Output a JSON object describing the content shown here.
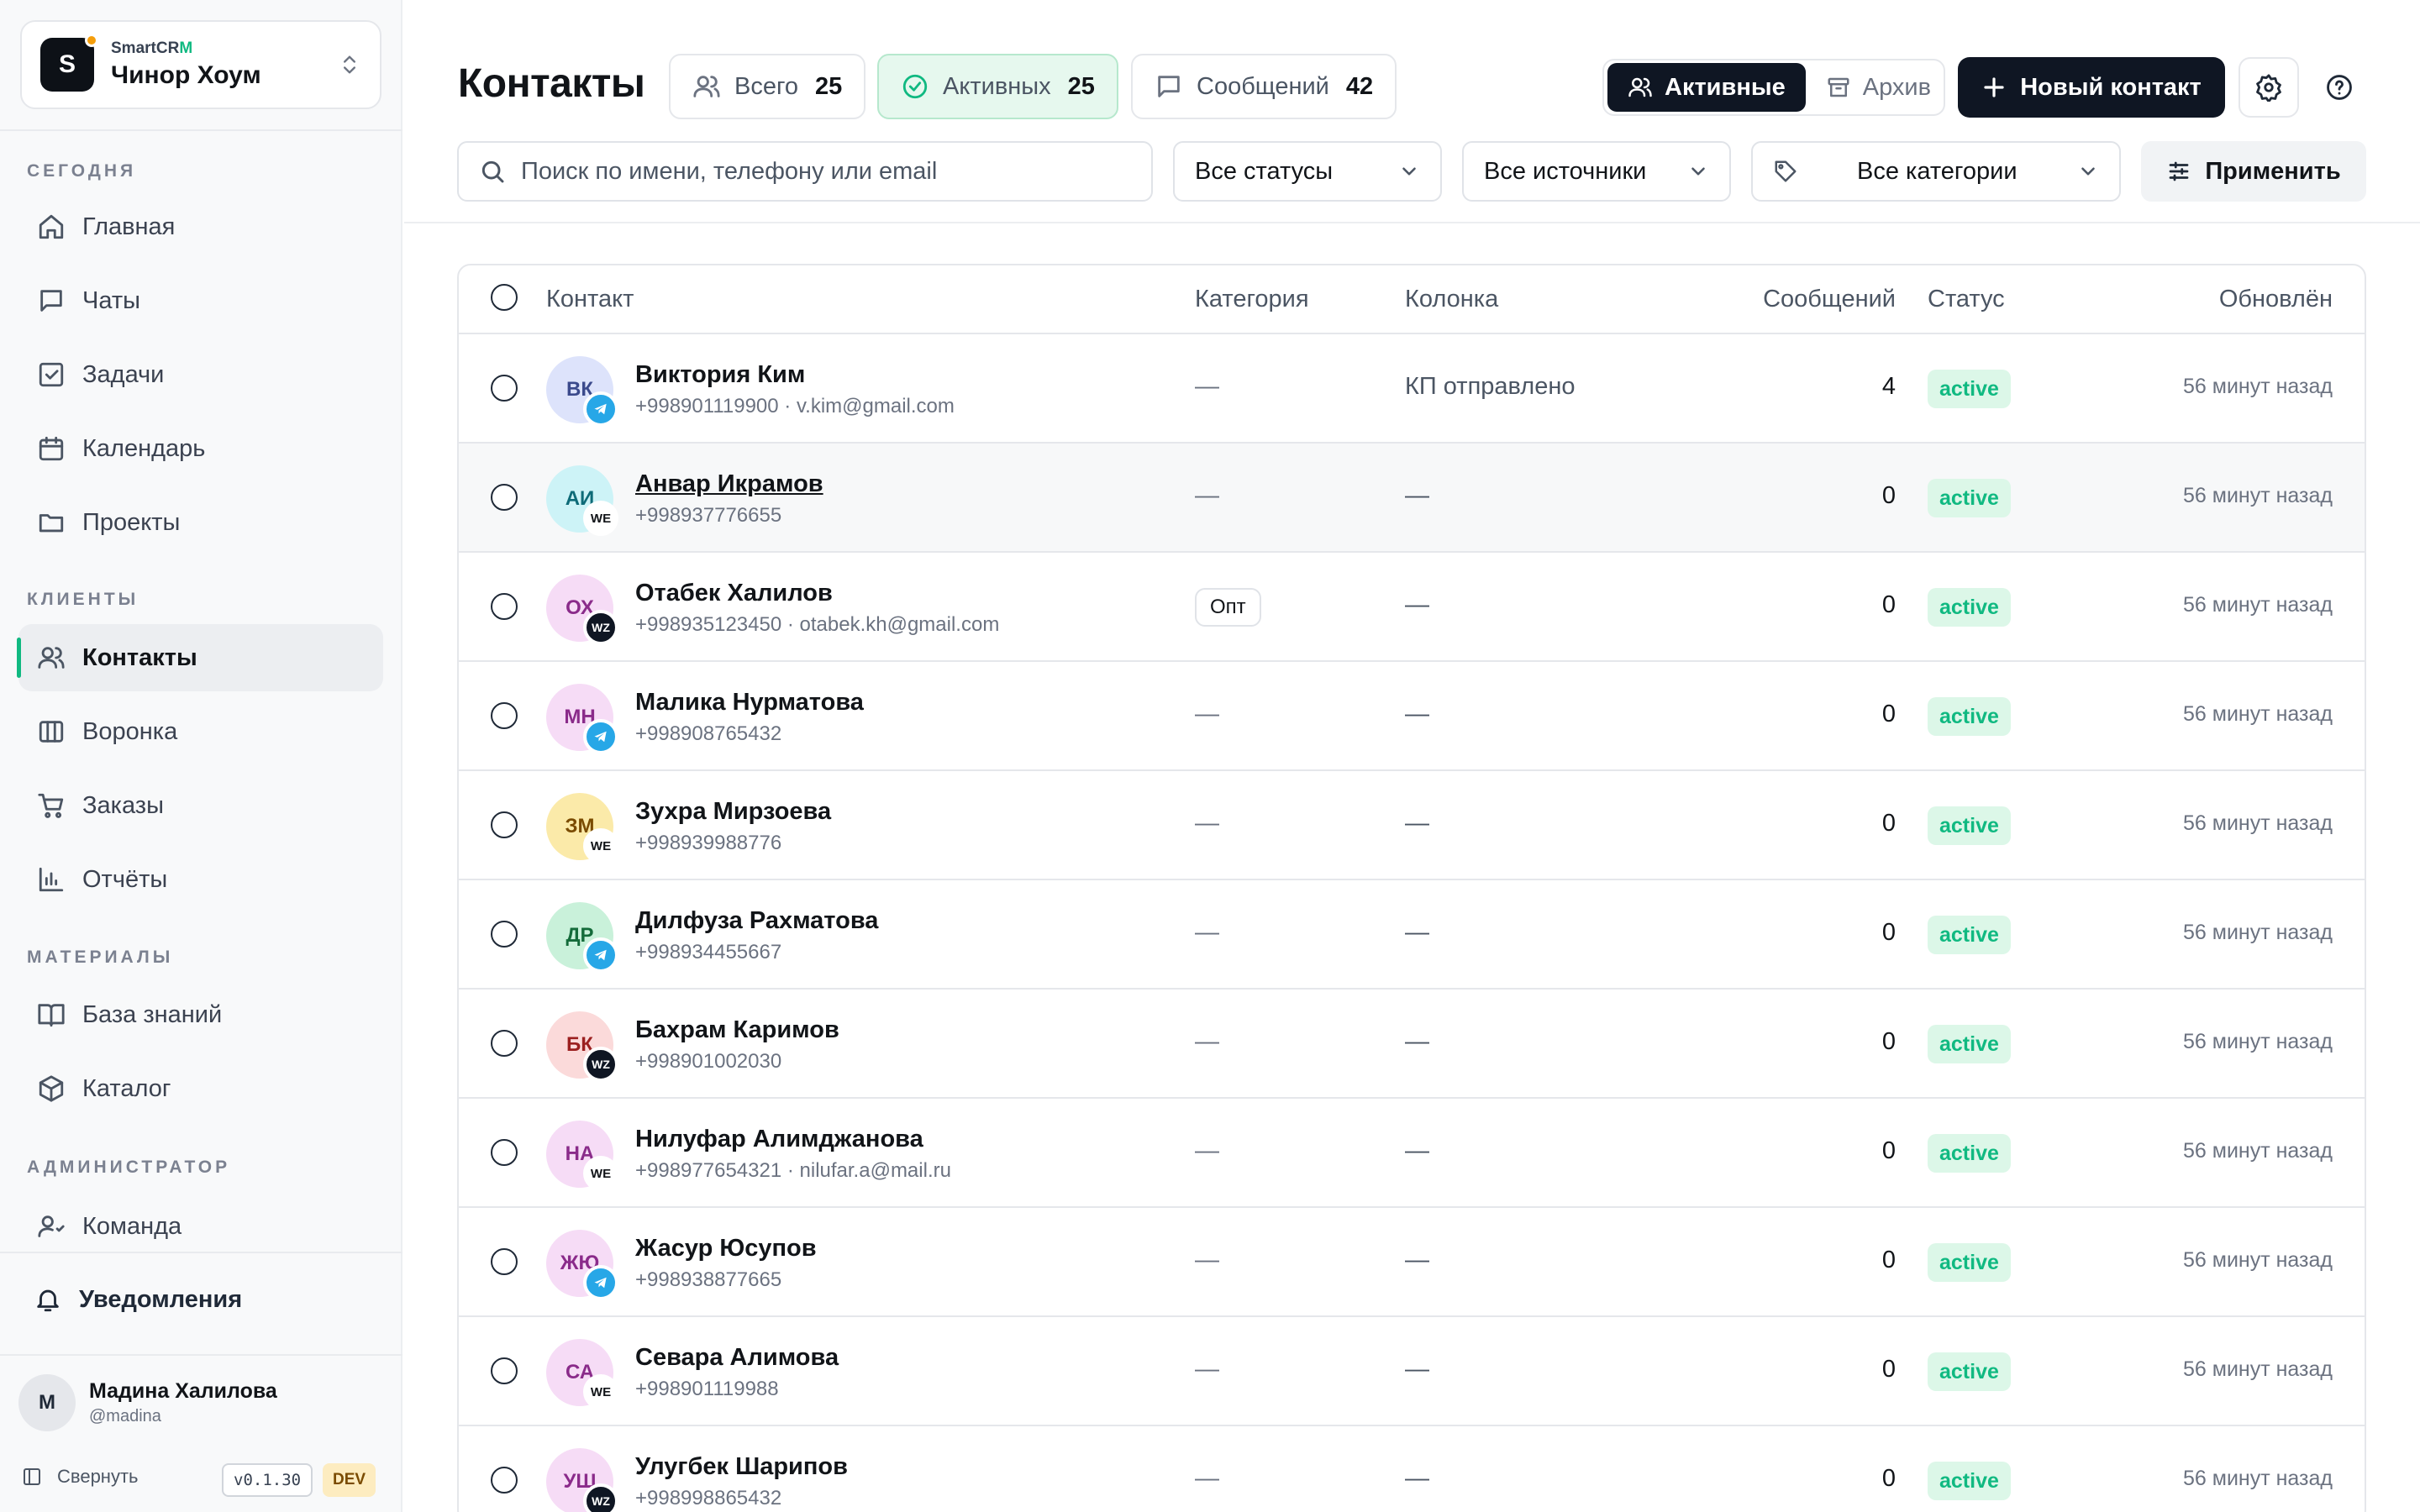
{
  "workspace": {
    "brand_main": "SmartCR",
    "brand_accent": "M",
    "logo_letter": "S",
    "name": "Чинор Хоум"
  },
  "sidebar": {
    "sections": [
      "СЕГОДНЯ",
      "КЛИЕНТЫ",
      "МАТЕРИАЛЫ",
      "АДМИНИСТРАТОР"
    ],
    "items": [
      {
        "label": "Главная",
        "icon": "home-icon"
      },
      {
        "label": "Чаты",
        "icon": "chat-icon"
      },
      {
        "label": "Задачи",
        "icon": "task-icon"
      },
      {
        "label": "Календарь",
        "icon": "calendar-icon"
      },
      {
        "label": "Проекты",
        "icon": "folder-icon"
      },
      {
        "label": "Контакты",
        "icon": "users-icon",
        "active": true
      },
      {
        "label": "Воронка",
        "icon": "columns-icon"
      },
      {
        "label": "Заказы",
        "icon": "cart-icon"
      },
      {
        "label": "Отчёты",
        "icon": "chart-icon"
      },
      {
        "label": "База знаний",
        "icon": "book-icon"
      },
      {
        "label": "Каталог",
        "icon": "box-icon"
      },
      {
        "label": "Команда",
        "icon": "team-icon"
      }
    ],
    "notifications": "Уведомления",
    "user": {
      "initial": "М",
      "name": "Мадина Халилова",
      "handle": "@madina"
    },
    "collapse": "Свернуть",
    "version": "v0.1.30",
    "env": "DEV"
  },
  "header": {
    "title": "Контакты",
    "stats": [
      {
        "label": "Всего",
        "value": "25"
      },
      {
        "label": "Активных",
        "value": "25"
      },
      {
        "label": "Сообщений",
        "value": "42"
      }
    ],
    "toggle": {
      "active": "Активные",
      "archive": "Архив"
    },
    "new_contact": "Новый контакт"
  },
  "filters": {
    "search_placeholder": "Поиск по имени, телефону или email",
    "status": "Все статусы",
    "source": "Все источники",
    "category": "Все категории",
    "apply": "Применить"
  },
  "table": {
    "columns": [
      "Контакт",
      "Категория",
      "Колонка",
      "Сообщений",
      "Статус",
      "Обновлён"
    ],
    "rows": [
      {
        "initials": "ВК",
        "name": "Виктория Ким",
        "sub": "+998901119900 · v.kim@gmail.com",
        "category": "—",
        "column": "КП отправлено",
        "messages": "4",
        "status": "active",
        "updated": "56 минут назад",
        "source": "tg",
        "bg": "#dde3fb",
        "fg": "#3b4a8c"
      },
      {
        "initials": "АИ",
        "name": "Анвар Икрамов",
        "sub": "+998937776655",
        "category": "—",
        "column": "—",
        "messages": "0",
        "status": "active",
        "updated": "56 минут назад",
        "source": "we",
        "bg": "#cdf3f7",
        "fg": "#0e6b78",
        "link": true,
        "hover": true
      },
      {
        "initials": "ОХ",
        "name": "Отабек Халилов",
        "sub": "+998935123450 · otabek.kh@gmail.com",
        "category": "Опт",
        "column": "—",
        "messages": "0",
        "status": "active",
        "updated": "56 минут назад",
        "source": "wz",
        "bg": "#f6dcf6",
        "fg": "#8a2b8a"
      },
      {
        "initials": "МН",
        "name": "Малика Нурматова",
        "sub": "+998908765432",
        "category": "—",
        "column": "—",
        "messages": "0",
        "status": "active",
        "updated": "56 минут назад",
        "source": "tg",
        "bg": "#f6dcf6",
        "fg": "#8a2b8a"
      },
      {
        "initials": "ЗМ",
        "name": "Зухра Мирзоева",
        "sub": "+998939988776",
        "category": "—",
        "column": "—",
        "messages": "0",
        "status": "active",
        "updated": "56 минут назад",
        "source": "we",
        "bg": "#fbeaa9",
        "fg": "#7a4b00"
      },
      {
        "initials": "ДР",
        "name": "Дилфуза Рахматова",
        "sub": "+998934455667",
        "category": "—",
        "column": "—",
        "messages": "0",
        "status": "active",
        "updated": "56 минут назад",
        "source": "tg",
        "bg": "#c9f1da",
        "fg": "#146b3a"
      },
      {
        "initials": "БК",
        "name": "Бахрам Каримов",
        "sub": "+998901002030",
        "category": "—",
        "column": "—",
        "messages": "0",
        "status": "active",
        "updated": "56 минут назад",
        "source": "wz",
        "bg": "#fbdada",
        "fg": "#9b2020"
      },
      {
        "initials": "НА",
        "name": "Нилуфар Алимджанова",
        "sub": "+998977654321 · nilufar.a@mail.ru",
        "category": "—",
        "column": "—",
        "messages": "0",
        "status": "active",
        "updated": "56 минут назад",
        "source": "we",
        "bg": "#f6dcf6",
        "fg": "#8a2b8a"
      },
      {
        "initials": "ЖЮ",
        "name": "Жасур Юсупов",
        "sub": "+998938877665",
        "category": "—",
        "column": "—",
        "messages": "0",
        "status": "active",
        "updated": "56 минут назад",
        "source": "tg",
        "bg": "#f6dcf6",
        "fg": "#8a2b8a"
      },
      {
        "initials": "СА",
        "name": "Севара Алимова",
        "sub": "+998901119988",
        "category": "—",
        "column": "—",
        "messages": "0",
        "status": "active",
        "updated": "56 минут назад",
        "source": "we",
        "bg": "#f6dcf6",
        "fg": "#8a2b8a"
      },
      {
        "initials": "УШ",
        "name": "Улугбек Шарипов",
        "sub": "+998998865432",
        "category": "—",
        "column": "—",
        "messages": "0",
        "status": "active",
        "updated": "56 минут назад",
        "source": "wz",
        "bg": "#f6dcf6",
        "fg": "#8a2b8a"
      }
    ]
  },
  "colors": {
    "accent": "#10b981",
    "dark": "#0f1623",
    "telegram": "#27a7e7",
    "active_bg": "#dcf7e8"
  }
}
